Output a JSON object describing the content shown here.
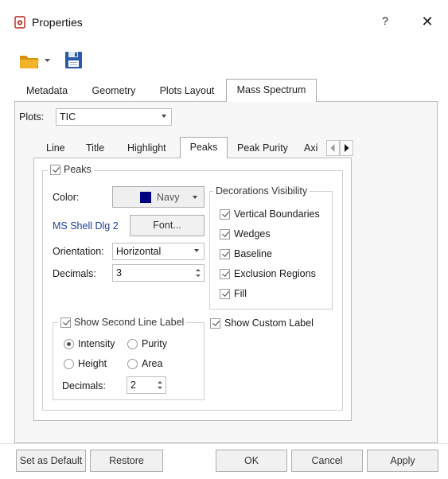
{
  "window": {
    "title": "Properties",
    "help_label": "?",
    "close_label": "✕"
  },
  "toolbar": {
    "open_icon": "folder-open-icon",
    "save_icon": "floppy-save-icon"
  },
  "main_tabs": [
    {
      "label": "Metadata",
      "active": false
    },
    {
      "label": "Geometry",
      "active": false
    },
    {
      "label": "Plots Layout",
      "active": false
    },
    {
      "label": "Mass Spectrum",
      "active": true
    }
  ],
  "plots": {
    "label": "Plots:",
    "value": "TIC"
  },
  "sub_tabs": [
    {
      "label": "Line",
      "active": false
    },
    {
      "label": "Title",
      "active": false
    },
    {
      "label": "Highlight",
      "active": false
    },
    {
      "label": "Peaks",
      "active": true
    },
    {
      "label": "Peak Purity",
      "active": false
    },
    {
      "label": "Axi",
      "active": false
    }
  ],
  "peaks": {
    "group_label": "Peaks",
    "checked": true,
    "color_label": "Color:",
    "color_value": "Navy",
    "color_swatch": "#000080",
    "font_name": "MS Shell Dlg 2",
    "font_button": "Font...",
    "orientation_label": "Orientation:",
    "orientation_value": "Horizontal",
    "decimals_label": "Decimals:",
    "decimals_value": "3"
  },
  "decorations": {
    "group_label": "Decorations Visibility",
    "items": [
      {
        "label": "Vertical Boundaries",
        "checked": true
      },
      {
        "label": "Wedges",
        "checked": true
      },
      {
        "label": "Baseline",
        "checked": true
      },
      {
        "label": "Exclusion Regions",
        "checked": true
      },
      {
        "label": "Fill",
        "checked": true
      }
    ]
  },
  "second_line": {
    "group_label": "Show Second Line Label",
    "checked": true,
    "radios": [
      {
        "label": "Intensity",
        "checked": true
      },
      {
        "label": "Purity",
        "checked": false
      },
      {
        "label": "Height",
        "checked": false
      },
      {
        "label": "Area",
        "checked": false
      }
    ],
    "decimals_label": "Decimals:",
    "decimals_value": "2"
  },
  "custom_label": {
    "label": "Show Custom Label",
    "checked": true
  },
  "footer": {
    "set_default": "Set as Default",
    "restore": "Restore",
    "ok": "OK",
    "cancel": "Cancel",
    "apply": "Apply"
  },
  "colors": {
    "link_text": "#1f3f9a",
    "accent_red": "#c0392b",
    "folder": "#e8a317",
    "save": "#2a5aa8"
  }
}
